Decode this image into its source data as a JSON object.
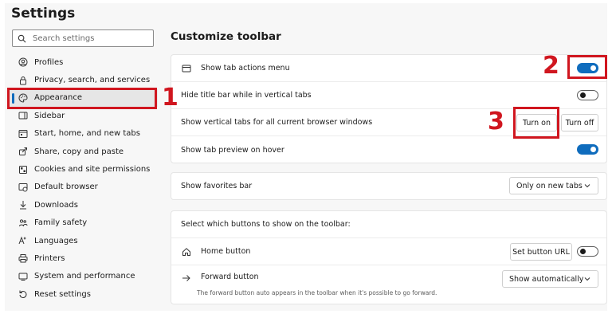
{
  "page_title": "Settings",
  "search": {
    "placeholder": "Search settings"
  },
  "sidebar": {
    "items": [
      {
        "label": "Profiles",
        "icon": "profile-icon"
      },
      {
        "label": "Privacy, search, and services",
        "icon": "lock-icon"
      },
      {
        "label": "Appearance",
        "icon": "appearance-icon",
        "active": true
      },
      {
        "label": "Sidebar",
        "icon": "sidebar-icon"
      },
      {
        "label": "Start, home, and new tabs",
        "icon": "start-home-icon"
      },
      {
        "label": "Share, copy and paste",
        "icon": "share-icon"
      },
      {
        "label": "Cookies and site permissions",
        "icon": "cookies-icon"
      },
      {
        "label": "Default browser",
        "icon": "default-browser-icon"
      },
      {
        "label": "Downloads",
        "icon": "download-icon"
      },
      {
        "label": "Family safety",
        "icon": "family-icon"
      },
      {
        "label": "Languages",
        "icon": "languages-icon"
      },
      {
        "label": "Printers",
        "icon": "printer-icon"
      },
      {
        "label": "System and performance",
        "icon": "system-icon"
      },
      {
        "label": "Reset settings",
        "icon": "reset-icon"
      }
    ]
  },
  "main": {
    "section_title": "Customize toolbar",
    "tab_settings": {
      "show_tab_actions_menu": {
        "label": "Show tab actions menu",
        "toggle": "on"
      },
      "hide_title_bar": {
        "label": "Hide title bar while in vertical tabs",
        "toggle": "off"
      },
      "vertical_tabs": {
        "label": "Show vertical tabs for all current browser windows",
        "turn_on": "Turn on",
        "turn_off": "Turn off"
      },
      "tab_preview": {
        "label": "Show tab preview on hover",
        "toggle": "on"
      }
    },
    "favorites": {
      "label": "Show favorites bar",
      "value": "Only on new tabs"
    },
    "toolbar_buttons": {
      "header": "Select which buttons to show on the toolbar:",
      "home": {
        "label": "Home button",
        "set_url": "Set button URL",
        "toggle": "off"
      },
      "forward": {
        "label": "Forward button",
        "value": "Show automatically",
        "description": "The forward button auto appears in the toolbar when it's possible to go forward."
      }
    }
  },
  "annotations": {
    "one": "1",
    "two": "2",
    "three": "3"
  },
  "colors": {
    "accent": "#0f6cbd",
    "highlight": "#d0161f"
  }
}
